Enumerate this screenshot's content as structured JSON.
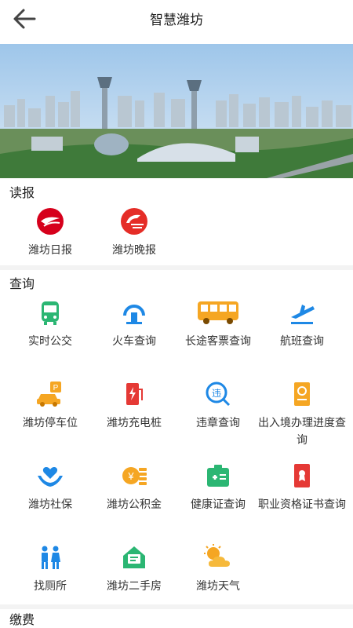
{
  "header": {
    "title": "智慧潍坊"
  },
  "sections": {
    "read": {
      "title": "读报",
      "items": [
        {
          "label": "潍坊日报",
          "icon": "weifang-daily-logo-icon"
        },
        {
          "label": "潍坊晚报",
          "icon": "weifang-evening-logo-icon"
        }
      ]
    },
    "query": {
      "title": "查询",
      "items": [
        {
          "label": "实时公交",
          "icon": "bus-icon"
        },
        {
          "label": "火车查询",
          "icon": "train-icon"
        },
        {
          "label": "长途客票查询",
          "icon": "coach-bus-icon"
        },
        {
          "label": "航班查询",
          "icon": "airplane-icon"
        },
        {
          "label": "潍坊停车位",
          "icon": "parking-car-icon"
        },
        {
          "label": "潍坊充电桩",
          "icon": "charging-pile-icon"
        },
        {
          "label": "违章查询",
          "icon": "violation-search-icon"
        },
        {
          "label": "出入境办理进度查询",
          "icon": "passport-icon"
        },
        {
          "label": "潍坊社保",
          "icon": "social-security-hands-icon"
        },
        {
          "label": "潍坊公积金",
          "icon": "housing-fund-coins-icon"
        },
        {
          "label": "健康证查询",
          "icon": "health-certificate-icon"
        },
        {
          "label": "职业资格证书查询",
          "icon": "certificate-icon"
        },
        {
          "label": "找厕所",
          "icon": "restroom-icon"
        },
        {
          "label": "潍坊二手房",
          "icon": "second-hand-house-icon"
        },
        {
          "label": "潍坊天气",
          "icon": "weather-sun-cloud-icon"
        }
      ]
    },
    "pay": {
      "title": "缴费"
    }
  },
  "colors": {
    "blue": "#1e88e5",
    "orange": "#f5a623",
    "red": "#e53935",
    "green": "#2bb673"
  }
}
